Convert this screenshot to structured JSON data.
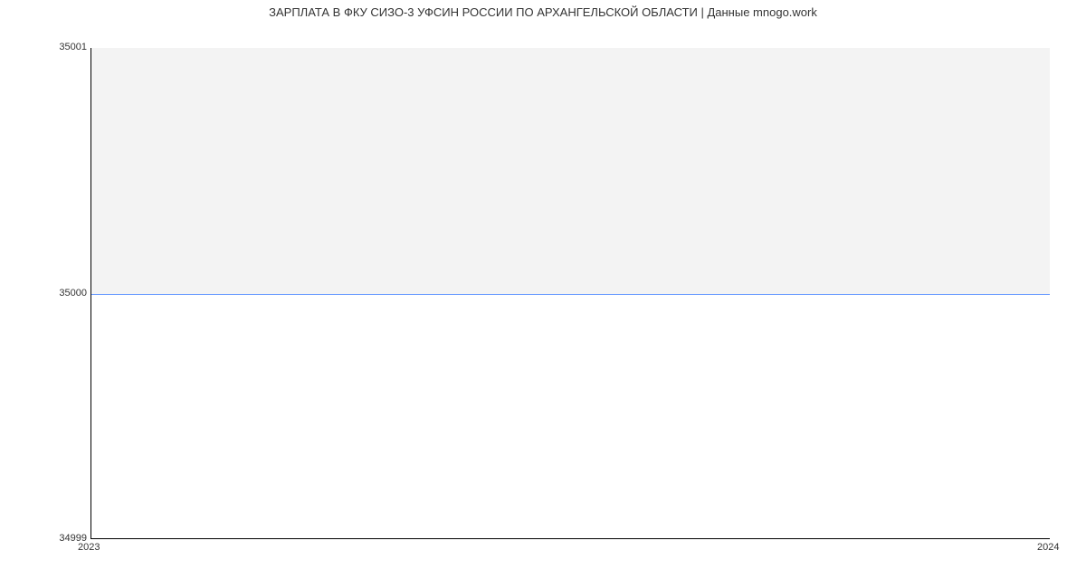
{
  "chart_data": {
    "type": "line",
    "title": "ЗАРПЛАТА В ФКУ СИЗО-3 УФСИН РОССИИ ПО АРХАНГЕЛЬСКОЙ ОБЛАСТИ | Данные mnogo.work",
    "x": [
      2023,
      2024
    ],
    "values": [
      35000,
      35000
    ],
    "xlabel": "",
    "ylabel": "",
    "x_ticks": [
      "2023",
      "2024"
    ],
    "y_ticks": [
      "34999",
      "35000",
      "35001"
    ],
    "xlim": [
      2023,
      2024
    ],
    "ylim": [
      34999,
      35001
    ],
    "line_color": "#6699ff",
    "fill_color": "#f3f3f3"
  }
}
